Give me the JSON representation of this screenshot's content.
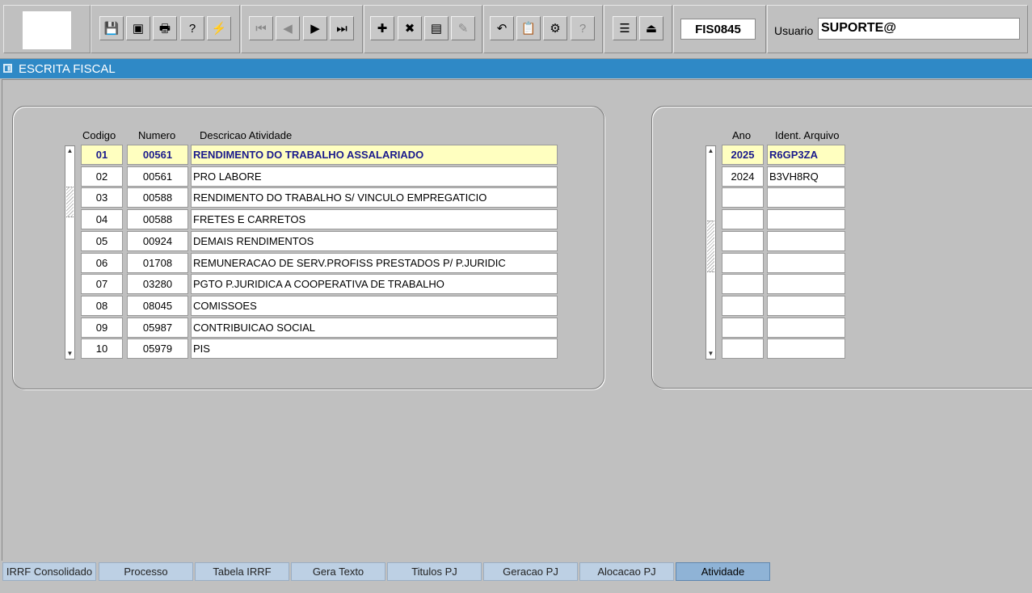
{
  "toolbar": {
    "form_code": "FIS0845",
    "user_label": "Usuario",
    "user_value": "SUPORTE@",
    "buttons": [
      {
        "icon": "save-icon",
        "glyph": "💾"
      },
      {
        "icon": "window-icon",
        "glyph": "▣"
      },
      {
        "icon": "print-icon",
        "glyph": "🖶"
      },
      {
        "icon": "query-icon",
        "glyph": "?"
      },
      {
        "icon": "execute-query-icon",
        "glyph": "⚡"
      },
      {
        "icon": "first-record-icon",
        "glyph": "⏮"
      },
      {
        "icon": "previous-record-icon",
        "glyph": "◀"
      },
      {
        "icon": "next-record-icon",
        "glyph": "▶"
      },
      {
        "icon": "last-record-icon",
        "glyph": "⏭"
      },
      {
        "icon": "insert-record-icon",
        "glyph": "✚"
      },
      {
        "icon": "delete-record-icon",
        "glyph": "✖"
      },
      {
        "icon": "list-of-values-icon",
        "glyph": "▤"
      },
      {
        "icon": "edit-icon",
        "glyph": "✎"
      },
      {
        "icon": "undo-icon",
        "glyph": "↶"
      },
      {
        "icon": "clipboard-icon",
        "glyph": "📋"
      },
      {
        "icon": "settings-icon",
        "glyph": "⚙"
      },
      {
        "icon": "help-icon",
        "glyph": "?"
      },
      {
        "icon": "menu-icon",
        "glyph": "☰"
      },
      {
        "icon": "exit-icon",
        "glyph": "⏏"
      }
    ]
  },
  "title": "ESCRITA FISCAL",
  "left_table": {
    "headers": {
      "codigo": "Codigo",
      "numero": "Numero",
      "descricao": "Descricao Atividade"
    },
    "rows": [
      {
        "codigo": "01",
        "numero": "00561",
        "descricao": "RENDIMENTO DO TRABALHO ASSALARIADO"
      },
      {
        "codigo": "02",
        "numero": "00561",
        "descricao": "PRO LABORE"
      },
      {
        "codigo": "03",
        "numero": "00588",
        "descricao": "RENDIMENTO DO TRABALHO S/ VINCULO EMPREGATICIO"
      },
      {
        "codigo": "04",
        "numero": "00588",
        "descricao": "FRETES E CARRETOS"
      },
      {
        "codigo": "05",
        "numero": "00924",
        "descricao": "DEMAIS RENDIMENTOS"
      },
      {
        "codigo": "06",
        "numero": "01708",
        "descricao": "REMUNERACAO DE SERV.PROFISS PRESTADOS P/ P.JURIDIC"
      },
      {
        "codigo": "07",
        "numero": "03280",
        "descricao": "PGTO P.JURIDICA A COOPERATIVA DE TRABALHO"
      },
      {
        "codigo": "08",
        "numero": "08045",
        "descricao": "COMISSOES"
      },
      {
        "codigo": "09",
        "numero": "05987",
        "descricao": "CONTRIBUICAO SOCIAL"
      },
      {
        "codigo": "10",
        "numero": "05979",
        "descricao": "PIS"
      }
    ]
  },
  "right_table": {
    "headers": {
      "ano": "Ano",
      "ident": "Ident. Arquivo"
    },
    "rows": [
      {
        "ano": "2025",
        "ident": "R6GP3ZA"
      },
      {
        "ano": "2024",
        "ident": "B3VH8RQ"
      },
      {
        "ano": "",
        "ident": ""
      },
      {
        "ano": "",
        "ident": ""
      },
      {
        "ano": "",
        "ident": ""
      },
      {
        "ano": "",
        "ident": ""
      },
      {
        "ano": "",
        "ident": ""
      },
      {
        "ano": "",
        "ident": ""
      },
      {
        "ano": "",
        "ident": ""
      },
      {
        "ano": "",
        "ident": ""
      }
    ]
  },
  "tabs": [
    {
      "label": "IRRF Consolidado",
      "active": false
    },
    {
      "label": "Processo",
      "active": false
    },
    {
      "label": "Tabela IRRF",
      "active": false
    },
    {
      "label": "Gera Texto",
      "active": false
    },
    {
      "label": "Titulos PJ",
      "active": false
    },
    {
      "label": "Geracao PJ",
      "active": false
    },
    {
      "label": "Alocacao PJ",
      "active": false
    },
    {
      "label": "Atividade",
      "active": true
    }
  ]
}
